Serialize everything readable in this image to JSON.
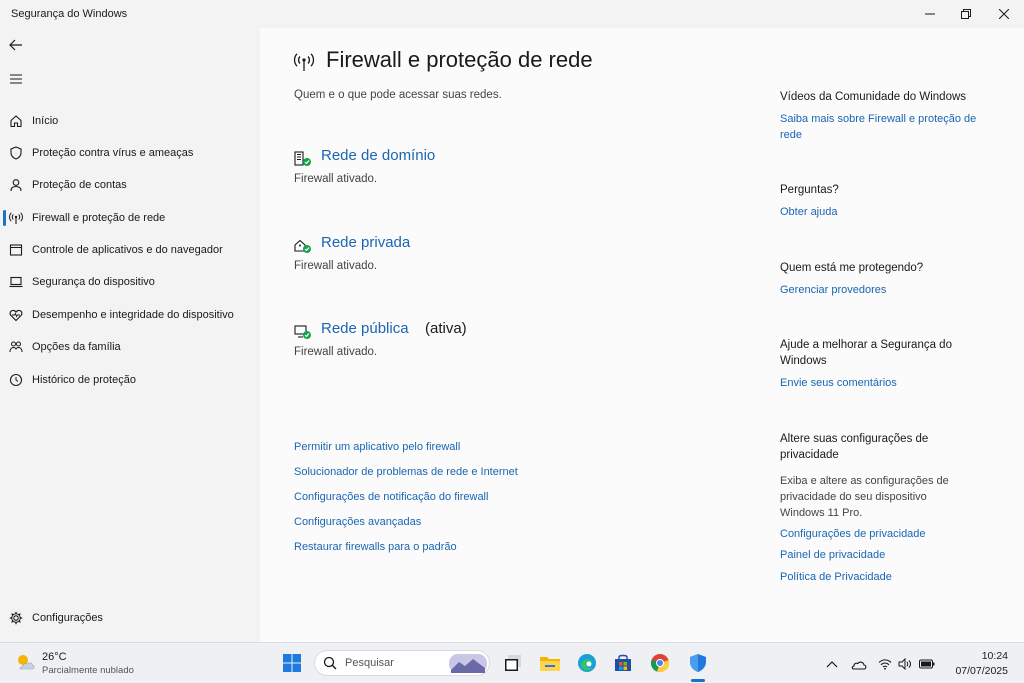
{
  "window": {
    "title": "Segurança do Windows"
  },
  "sidebar": {
    "items": [
      {
        "label": "Início",
        "icon": "home-icon"
      },
      {
        "label": "Proteção contra vírus e ameaças",
        "icon": "shield-icon"
      },
      {
        "label": "Proteção de contas",
        "icon": "person-icon"
      },
      {
        "label": "Firewall e proteção de rede",
        "icon": "antenna-icon",
        "active": true
      },
      {
        "label": "Controle de aplicativos e do navegador",
        "icon": "app-window-icon"
      },
      {
        "label": "Segurança do dispositivo",
        "icon": "laptop-icon"
      },
      {
        "label": "Desempenho e integridade do dispositivo",
        "icon": "heart-icon"
      },
      {
        "label": "Opções da família",
        "icon": "family-icon"
      },
      {
        "label": "Histórico de proteção",
        "icon": "history-icon"
      }
    ],
    "settings_label": "Configurações"
  },
  "main": {
    "title": "Firewall e proteção de rede",
    "subtitle": "Quem e o que pode acessar suas redes.",
    "networks": [
      {
        "name": "Rede de domínio",
        "status": "Firewall ativado.",
        "active_label": ""
      },
      {
        "name": "Rede privada",
        "status": "Firewall ativado.",
        "active_label": ""
      },
      {
        "name": "Rede pública",
        "status": "Firewall ativado.",
        "active_label": "(ativa)"
      }
    ],
    "links": [
      "Permitir um aplicativo pelo firewall",
      "Solucionador de problemas de rede e Internet",
      "Configurações de notificação do firewall",
      "Configurações avançadas",
      "Restaurar firewalls para o padrão"
    ]
  },
  "right": {
    "videos_heading": "Vídeos da Comunidade do Windows",
    "videos_link": "Saiba mais sobre Firewall e proteção de rede",
    "questions_heading": "Perguntas?",
    "questions_link": "Obter ajuda",
    "protecting_heading": "Quem está me protegendo?",
    "protecting_link": "Gerenciar provedores",
    "improve_heading": "Ajude a melhorar a Segurança do Windows",
    "improve_link": "Envie seus comentários",
    "privacy_heading": "Altere suas configurações de privacidade",
    "privacy_text": "Exiba e altere as configurações de privacidade do seu dispositivo Windows 11 Pro.",
    "privacy_links": [
      "Configurações de privacidade",
      "Painel de privacidade",
      "Política de Privacidade"
    ]
  },
  "taskbar": {
    "weather_temp": "26°C",
    "weather_desc": "Parcialmente nublado",
    "search_placeholder": "Pesquisar",
    "time": "10:24",
    "date": "07/07/2025"
  },
  "colors": {
    "accent": "#1a73c8",
    "link": "#1a66b3",
    "status_ok": "#16a34a"
  }
}
